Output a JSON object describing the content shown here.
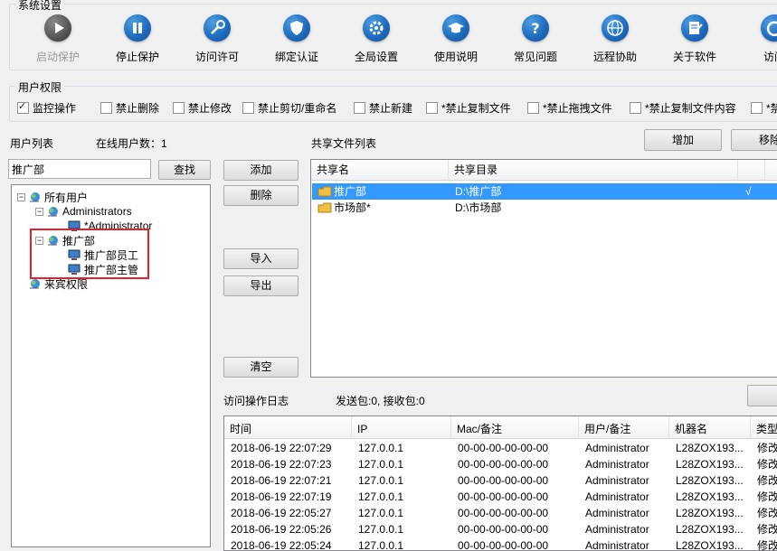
{
  "system_settings": {
    "title": "系统设置",
    "tools": [
      {
        "label": "启动保护",
        "icon": "play-icon",
        "enabled": false
      },
      {
        "label": "停止保护",
        "icon": "pause-icon",
        "enabled": true
      },
      {
        "label": "访问许可",
        "icon": "key-icon",
        "enabled": true
      },
      {
        "label": "绑定认证",
        "icon": "shield-icon",
        "enabled": true
      },
      {
        "label": "全局设置",
        "icon": "gear-icon",
        "enabled": true
      },
      {
        "label": "使用说明",
        "icon": "graduation-cap-icon",
        "enabled": true
      },
      {
        "label": "常见问题",
        "icon": "question-icon",
        "enabled": true
      },
      {
        "label": "远程协助",
        "icon": "globe-icon",
        "enabled": true
      },
      {
        "label": "关于软件",
        "icon": "document-icon",
        "enabled": true
      },
      {
        "label": "访问",
        "icon": "refresh-icon",
        "enabled": true
      }
    ]
  },
  "user_permissions": {
    "title": "用户权限",
    "options": [
      {
        "label": "监控操作",
        "checked": true
      },
      {
        "label": "禁止删除",
        "checked": false
      },
      {
        "label": "禁止修改",
        "checked": false
      },
      {
        "label": "禁止剪切/重命名",
        "checked": false
      },
      {
        "label": "禁止新建",
        "checked": false
      },
      {
        "label": "*禁止复制文件",
        "checked": false
      },
      {
        "label": "*禁止拖拽文件",
        "checked": false
      },
      {
        "label": "*禁止复制文件内容",
        "checked": false
      },
      {
        "label": "*禁",
        "checked": false
      }
    ]
  },
  "user_list": {
    "title": "用户列表",
    "online_label": "在线用户数：",
    "online_count": "1",
    "search_value": "推广部",
    "search_button": "查找",
    "tree": [
      {
        "label": "所有用户",
        "level": 0,
        "expander": "⊟",
        "icon": "users-icon"
      },
      {
        "label": "Administrators",
        "level": 1,
        "expander": "⊟",
        "icon": "users-icon"
      },
      {
        "label": "*Administrator",
        "level": 2,
        "expander": "",
        "icon": "computer-icon"
      },
      {
        "label": "推广部",
        "level": 1,
        "expander": "⊟",
        "icon": "users-icon"
      },
      {
        "label": "推广部员工",
        "level": 2,
        "expander": "",
        "icon": "computer-icon"
      },
      {
        "label": "推广部主管",
        "level": 2,
        "expander": "",
        "icon": "computer-icon"
      },
      {
        "label": "来宾权限",
        "level": 0,
        "expander": "",
        "icon": "users-icon"
      }
    ]
  },
  "middle_buttons": {
    "add": "添加",
    "delete": "删除",
    "import": "导入",
    "export": "导出",
    "clear": "清空"
  },
  "shared_files": {
    "title": "共享文件列表",
    "add_button": "增加",
    "remove_button": "移除",
    "columns": [
      "共享名",
      "共享目录"
    ],
    "rows": [
      {
        "name": "推广部",
        "path": "D:\\推广部",
        "mark": "√",
        "selected": true
      },
      {
        "name": "市场部*",
        "path": "D:\\市场部",
        "mark": "",
        "selected": false
      }
    ]
  },
  "log": {
    "title": "访问操作日志",
    "packets": "发送包:0, 接收包:0",
    "columns": [
      "时间",
      "IP",
      "Mac/备注",
      "用户/备注",
      "机器名",
      "类型"
    ],
    "rows": [
      [
        "2018-06-19 22:07:29",
        "127.0.0.1",
        "00-00-00-00-00-00",
        "Administrator",
        "L28ZOX193...",
        "修改"
      ],
      [
        "2018-06-19 22:07:23",
        "127.0.0.1",
        "00-00-00-00-00-00",
        "Administrator",
        "L28ZOX193...",
        "修改"
      ],
      [
        "2018-06-19 22:07:21",
        "127.0.0.1",
        "00-00-00-00-00-00",
        "Administrator",
        "L28ZOX193...",
        "修改"
      ],
      [
        "2018-06-19 22:07:19",
        "127.0.0.1",
        "00-00-00-00-00-00",
        "Administrator",
        "L28ZOX193...",
        "修改"
      ],
      [
        "2018-06-19 22:05:27",
        "127.0.0.1",
        "00-00-00-00-00-00",
        "Administrator",
        "L28ZOX193...",
        "修改"
      ],
      [
        "2018-06-19 22:05:26",
        "127.0.0.1",
        "00-00-00-00-00-00",
        "Administrator",
        "L28ZOX193...",
        "修改"
      ],
      [
        "2018-06-19 22:05:24",
        "127.0.0.1",
        "00-00-00-00-00-00",
        "Administrator",
        "L28ZOX193...",
        "修改"
      ]
    ]
  },
  "colors": {
    "selection": "#3399ff",
    "highlight_box": "#e8202a",
    "icon_blue": "#1e6cc0"
  }
}
